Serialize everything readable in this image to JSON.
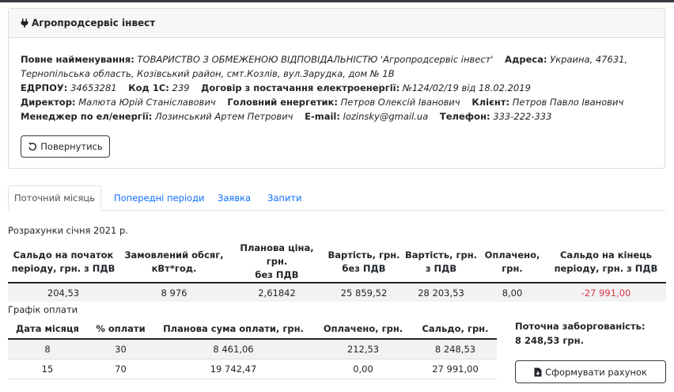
{
  "company": {
    "title": "Агропродсервіс інвест"
  },
  "info": {
    "full_name_label": "Повне найменування:",
    "full_name": "ТОВАРИСТВО З ОБМЕЖЕНОЮ ВІДПОВІДАЛЬНІСТЮ 'Агропродсервіс інвест'",
    "address_label": "Адреса:",
    "address": "Украина, 47631, Тернопільська область, Козівський район, смт.Козлів, вул.Зарудка, дом № 1В",
    "edrpou_label": "ЕДРПОУ:",
    "edrpou": "34653281",
    "code1c_label": "Код 1С:",
    "code1c": "239",
    "contract_label": "Договір з постачання електроенергії:",
    "contract": "№124/02/19 від 18.02.2019",
    "director_label": "Директор:",
    "director": "Малюта Юрій Станіславович",
    "chief_energy_label": "Головний енергетик:",
    "chief_energy": "Петров Олексій Іванович",
    "client_label": "Клієнт:",
    "client": "Петров Павло Іванович",
    "manager_label": "Менеджер по ел/енергії:",
    "manager": "Лозинський Артем Петрович",
    "email_label": "E-mail:",
    "email": "lozinsky@gmail.ua",
    "phone_label": "Телефон:",
    "phone": "333-222-333"
  },
  "buttons": {
    "back": "Повернутись",
    "invoice": "Сформувати рахунок"
  },
  "tabs": [
    "Поточний місяць",
    "Попередні періоди",
    "Заявка",
    "Запити"
  ],
  "calc": {
    "title": "Розрахунки січня 2021 р.",
    "headers": [
      [
        "Сальдо на початок",
        "періоду, грн. з ПДВ"
      ],
      [
        "Замовлений обсяг,",
        "кВт*год."
      ],
      [
        "Планова ціна, грн.",
        "без ПДВ"
      ],
      [
        "Вартість, грн.",
        "без ПДВ"
      ],
      [
        "Вартість, грн.",
        "з ПДВ"
      ],
      [
        "Оплачено,",
        "грн."
      ],
      [
        "Сальдо на кінець",
        "періоду, грн. з ПДВ"
      ]
    ],
    "row": [
      "204,53",
      "8 976",
      "2,61842",
      "25 859,52",
      "28 203,53",
      "8,00",
      "-27 991,00"
    ]
  },
  "schedule": {
    "title": "Графік оплати",
    "headers": [
      "Дата місяця",
      "% оплати",
      "Планова сума оплати, грн.",
      "Оплачено, грн.",
      "Сальдо, грн."
    ],
    "rows": [
      [
        "8",
        "30",
        "8 461,06",
        "212,53",
        "8 248,53"
      ],
      [
        "15",
        "70",
        "19 742,47",
        "0,00",
        "27 991,00"
      ]
    ]
  },
  "debt": {
    "label": "Поточна заборгованість:",
    "value": "8 248,53 грн."
  },
  "colors": {
    "negative": "#dc3545",
    "link": "#0d6efd",
    "dark": "#343a40"
  }
}
